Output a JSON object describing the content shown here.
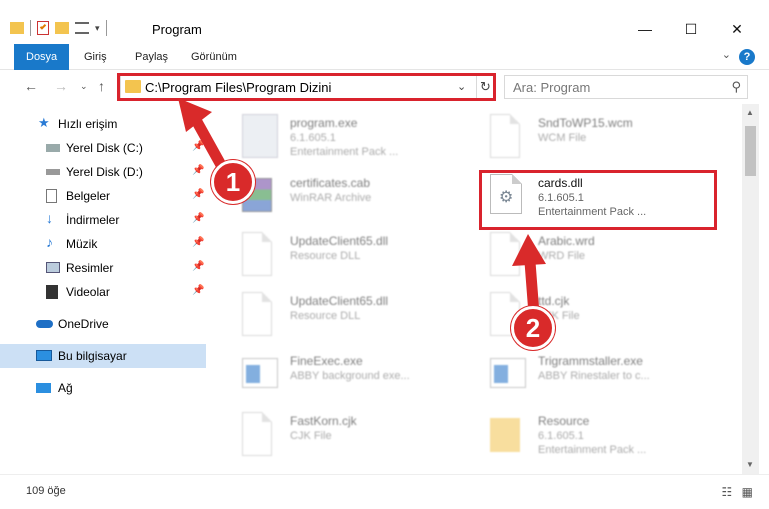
{
  "window": {
    "title": "Program",
    "minimize": "—",
    "maximize": "☐",
    "close": "✕"
  },
  "ribbon": {
    "tabs": [
      {
        "label": "Dosya",
        "active": true
      },
      {
        "label": "Giriş"
      },
      {
        "label": "Paylaş"
      },
      {
        "label": "Görünüm"
      }
    ],
    "help": "?"
  },
  "address": {
    "path": "C:\\Program Files\\Program Dizini",
    "search_placeholder": "Ara: Program"
  },
  "sidebar": {
    "items": [
      {
        "label": "Hızlı erişim",
        "icon": "star-icon"
      },
      {
        "label": "Yerel Disk (C:)",
        "icon": "drive-icon",
        "pinned": true
      },
      {
        "label": "Yerel Disk (D:)",
        "icon": "drive-icon",
        "pinned": true
      },
      {
        "label": "Belgeler",
        "icon": "documents-icon",
        "pinned": true
      },
      {
        "label": "İndirmeler",
        "icon": "download-icon",
        "pinned": true
      },
      {
        "label": "Müzik",
        "icon": "music-icon",
        "pinned": true
      },
      {
        "label": "Resimler",
        "icon": "pictures-icon",
        "pinned": true
      },
      {
        "label": "Videolar",
        "icon": "videos-icon",
        "pinned": true
      },
      {
        "label": "OneDrive",
        "icon": "cloud-icon"
      },
      {
        "label": "Bu bilgisayar",
        "icon": "computer-icon",
        "selected": true
      },
      {
        "label": "Ağ",
        "icon": "network-icon"
      }
    ]
  },
  "files": {
    "left": [
      {
        "name": "program.exe",
        "line1": "6.1.605.1",
        "line2": "Entertainment Pack ..."
      },
      {
        "name": "certificates.cab",
        "line1": "WinRAR Archive"
      },
      {
        "name": "UpdateClient65.dll",
        "line1": "Resource DLL"
      },
      {
        "name": "UpdateClient65.dll",
        "line1": "Resource DLL"
      },
      {
        "name": "FineExec.exe",
        "line1": "ABBY background exe..."
      },
      {
        "name": "FastKorn.cjk",
        "line1": "CJK File"
      }
    ],
    "right": [
      {
        "name": "SndToWP15.wcm",
        "line1": "WCM File"
      },
      {
        "name": "cards.dll",
        "line1": "6.1.605.1",
        "line2": "Entertainment Pack ..."
      },
      {
        "name": "Arabic.wrd",
        "line1": "WRD File"
      },
      {
        "name": "ttd.cjk",
        "line1": "CJK File"
      },
      {
        "name": "Trigrammstaller.exe",
        "line1": "ABBY Rinestaler to c..."
      },
      {
        "name": "Resource",
        "line1": "6.1.605.1",
        "line2": "Entertainment Pack ..."
      }
    ]
  },
  "status": {
    "count": "109 öğe"
  },
  "annotations": {
    "step1": "1",
    "step2": "2",
    "color": "#d9232d"
  }
}
